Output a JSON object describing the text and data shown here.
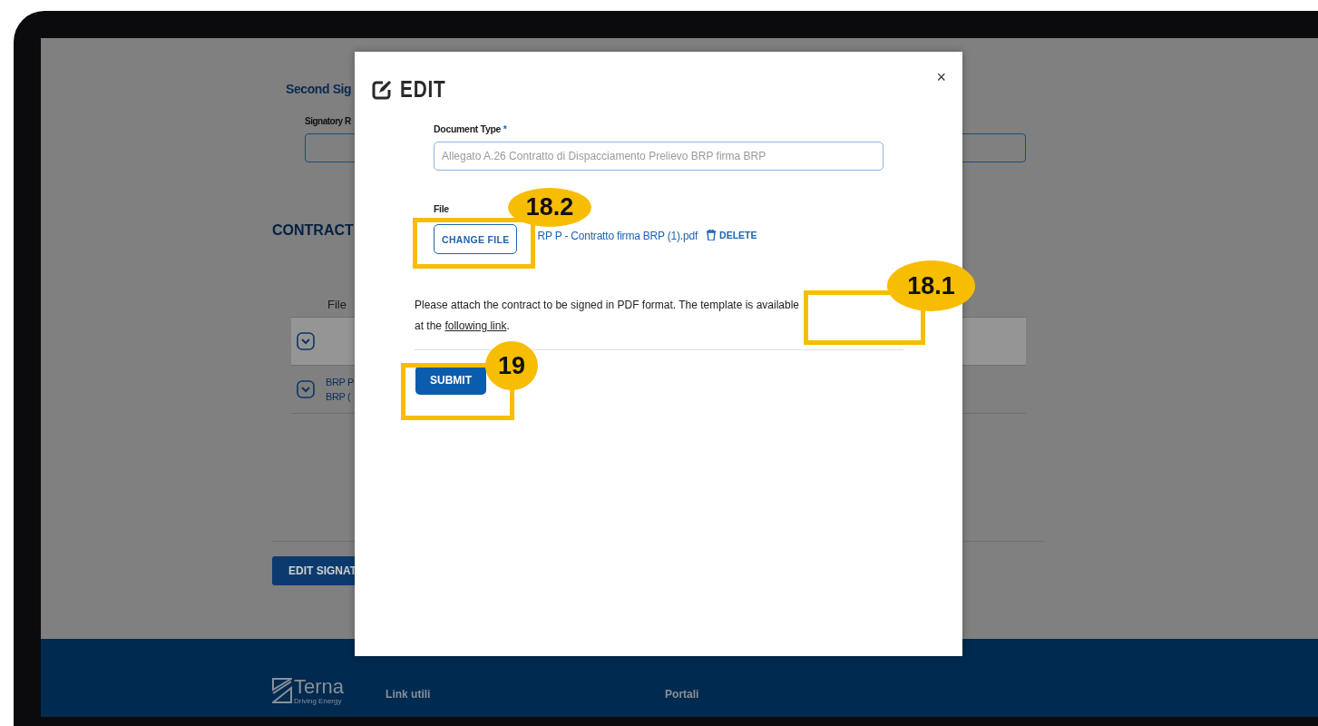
{
  "background_page": {
    "section_title": "Second Sig",
    "field_label": "Signatory R",
    "contract_title": "CONTRACT",
    "table": {
      "columns": [
        "File"
      ],
      "rows": [
        {
          "shaded": true
        },
        {
          "shaded": false,
          "lines": [
            "BRP P",
            "BRP ("
          ]
        }
      ]
    },
    "edit_button": "EDIT SIGNAT"
  },
  "footer": {
    "logo_name": "Terna",
    "logo_tagline": "Driving Energy",
    "columns": [
      "Link utili",
      "Portali"
    ]
  },
  "modal": {
    "title": "EDIT",
    "close": "×",
    "document_type": {
      "label": "Document Type",
      "required_mark": "*",
      "value": "Allegato A.26 Contratto di Dispacciamento Prelievo BRP firma BRP"
    },
    "file": {
      "label": "File",
      "change_button": "CHANGE FILE",
      "file_name": "RP P - Contratto firma BRP (1).pdf",
      "delete": "DELETE"
    },
    "note": {
      "text": "Please attach the contract to be signed in PDF format. The template is available at the",
      "link": "following link",
      "end": "."
    },
    "submit": "SUBMIT"
  },
  "annotations": [
    {
      "label": "18.2"
    },
    {
      "label": "18.1"
    },
    {
      "label": "19"
    }
  ]
}
